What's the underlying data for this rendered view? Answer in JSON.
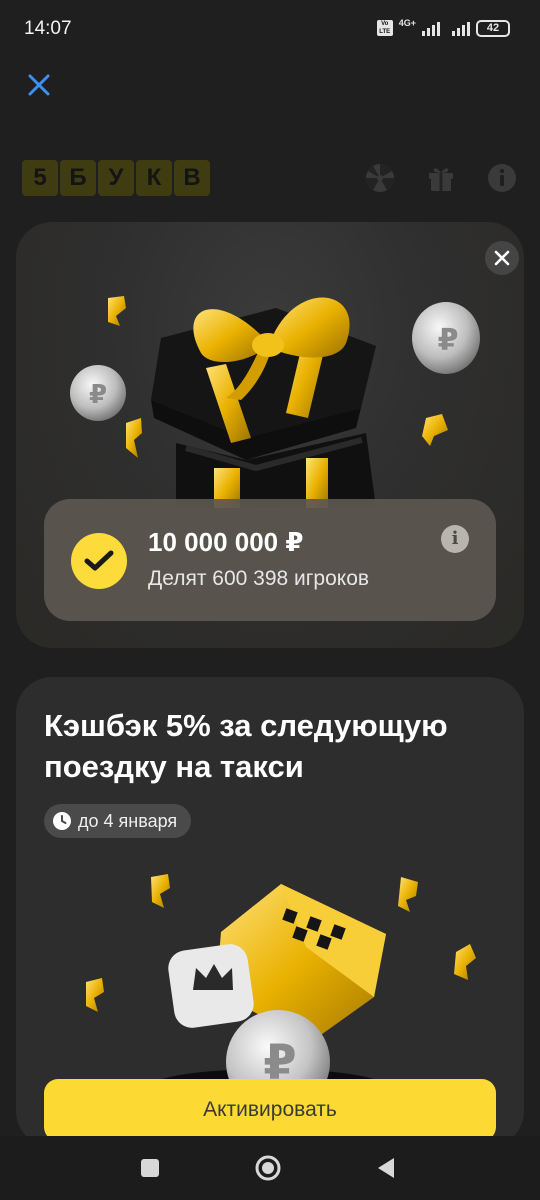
{
  "status_bar": {
    "time": "14:07",
    "volte_label": "Vo LTE",
    "network_label": "4G+",
    "battery": "42"
  },
  "header": {
    "close_icon": "close-icon",
    "logo_letters": [
      "5",
      "Б",
      "У",
      "К",
      "В"
    ],
    "icons": [
      "wheel-icon",
      "gift-icon",
      "info-icon"
    ]
  },
  "prize_card": {
    "amount": "10 000 000 ₽",
    "players": "Делят 600 398 игроков",
    "info_label": "i"
  },
  "cashback_card": {
    "title": "Кэшбэк 5% за следующую поездку на такси",
    "deadline": "до 4 января",
    "activate_label": "Активировать"
  },
  "colors": {
    "accent_yellow": "#fcd933",
    "card_bg": "#2d2d2d",
    "link_blue": "#3d8ff5"
  }
}
